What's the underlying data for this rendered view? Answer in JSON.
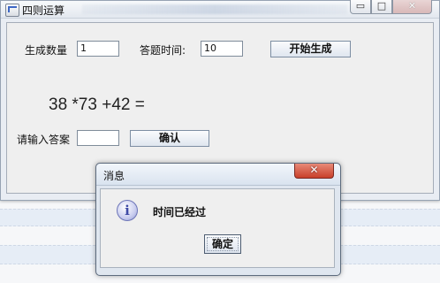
{
  "window": {
    "title": "四则运算",
    "minimize_glyph": "▭",
    "maximize_glyph": "□",
    "close_glyph": "✕"
  },
  "form": {
    "count_label": "生成数量",
    "count_value": "1",
    "time_label": "答题时间:",
    "time_value": "10",
    "generate_label": "开始生成",
    "equation": "38 *73 +42  =",
    "answer_label": "请输入答案",
    "answer_value": "",
    "confirm_label": "确认"
  },
  "dialog": {
    "title": "消息",
    "close_glyph": "✕",
    "icon_glyph": "i",
    "message": "时间已经过",
    "ok_label": "确定"
  },
  "colors": {
    "accent": "#3d67c5",
    "dialog_close": "#c8402a",
    "info_icon": "#3e4aa6"
  },
  "icons": {
    "app": "window-app-icon",
    "info": "info-icon"
  }
}
